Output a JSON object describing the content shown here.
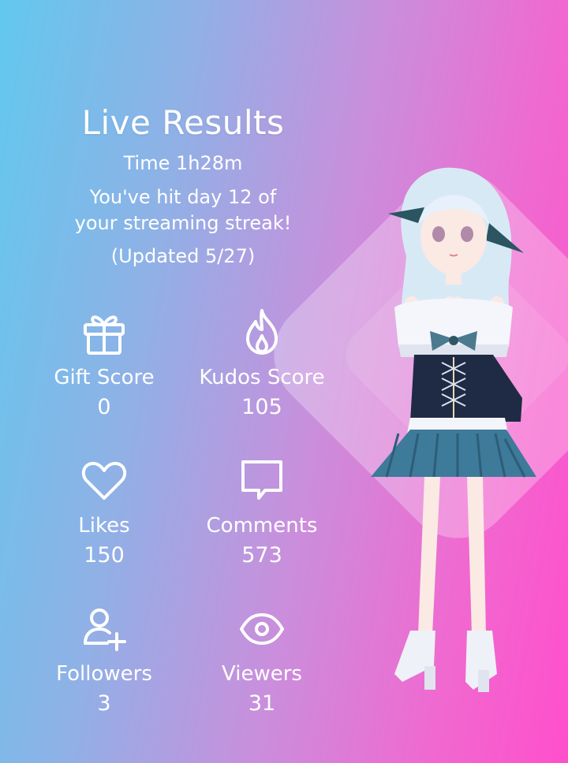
{
  "header": {
    "title": "Live Results",
    "time": "Time 1h28m",
    "streak_line1": "You've hit day 12 of",
    "streak_line2": "your streaming streak!",
    "updated": "(Updated 5/27)"
  },
  "stats": [
    {
      "icon": "gift-icon",
      "label": "Gift Score",
      "value": "0"
    },
    {
      "icon": "flame-icon",
      "label": "Kudos Score",
      "value": "105"
    },
    {
      "icon": "heart-icon",
      "label": "Likes",
      "value": "150"
    },
    {
      "icon": "comment-icon",
      "label": "Comments",
      "value": "573"
    },
    {
      "icon": "add-user-icon",
      "label": "Followers",
      "value": "3"
    },
    {
      "icon": "eye-icon",
      "label": "Viewers",
      "value": "31"
    }
  ],
  "colors": {
    "gradient_left": "#62c8ee",
    "gradient_right": "#ff4fcb",
    "text": "#ffffff"
  }
}
